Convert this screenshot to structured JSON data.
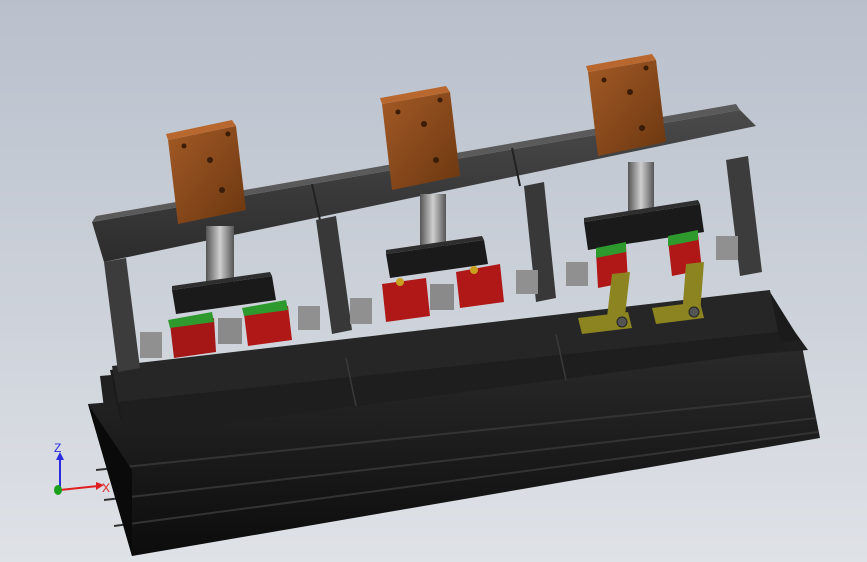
{
  "viewport": {
    "background_top": "#b9c0cc",
    "background_bottom": "#dfe2e7"
  },
  "triad": {
    "z_label": "Z",
    "x_label": "X",
    "z_color": "#2b2be0",
    "x_color": "#e02020",
    "y_color": "#1aa01a"
  },
  "model": {
    "actuators": [
      "cylinder-left",
      "cylinder-center",
      "cylinder-right"
    ],
    "colors": {
      "cylinder_body": "#8a4a1e",
      "frame": "#3a3a3a",
      "base": "#161616",
      "block_red": "#b01818",
      "block_green": "#2e9a2e",
      "clamp_yellow": "#8c8420"
    }
  }
}
